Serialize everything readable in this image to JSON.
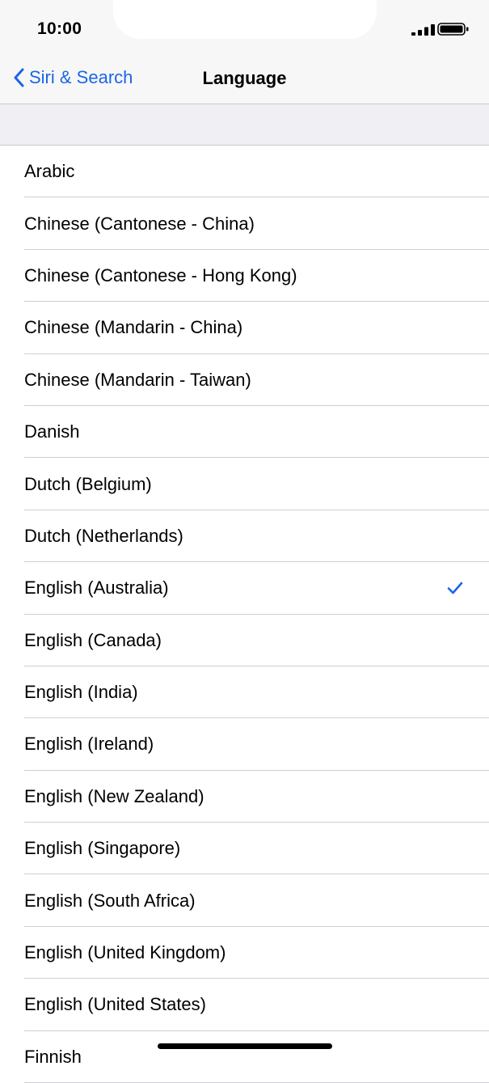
{
  "status_bar": {
    "time": "10:00"
  },
  "nav": {
    "back_label": "Siri & Search",
    "title": "Language"
  },
  "languages": [
    {
      "label": "Arabic",
      "selected": false
    },
    {
      "label": "Chinese (Cantonese - China)",
      "selected": false
    },
    {
      "label": "Chinese (Cantonese - Hong Kong)",
      "selected": false
    },
    {
      "label": "Chinese (Mandarin - China)",
      "selected": false
    },
    {
      "label": "Chinese (Mandarin - Taiwan)",
      "selected": false
    },
    {
      "label": "Danish",
      "selected": false
    },
    {
      "label": "Dutch (Belgium)",
      "selected": false
    },
    {
      "label": "Dutch (Netherlands)",
      "selected": false
    },
    {
      "label": "English (Australia)",
      "selected": true
    },
    {
      "label": "English (Canada)",
      "selected": false
    },
    {
      "label": "English (India)",
      "selected": false
    },
    {
      "label": "English (Ireland)",
      "selected": false
    },
    {
      "label": "English (New Zealand)",
      "selected": false
    },
    {
      "label": "English (Singapore)",
      "selected": false
    },
    {
      "label": "English (South Africa)",
      "selected": false
    },
    {
      "label": "English (United Kingdom)",
      "selected": false
    },
    {
      "label": "English (United States)",
      "selected": false
    },
    {
      "label": "Finnish",
      "selected": false
    }
  ],
  "colors": {
    "accent": "#1a66e8",
    "bar_background": "#f7f7f7",
    "group_background": "#efeff4",
    "separator": "#cfcfd4"
  },
  "icons": {
    "back": "chevron-left-icon",
    "signal": "cellular-signal-icon",
    "battery": "battery-icon",
    "selected": "checkmark-icon"
  }
}
